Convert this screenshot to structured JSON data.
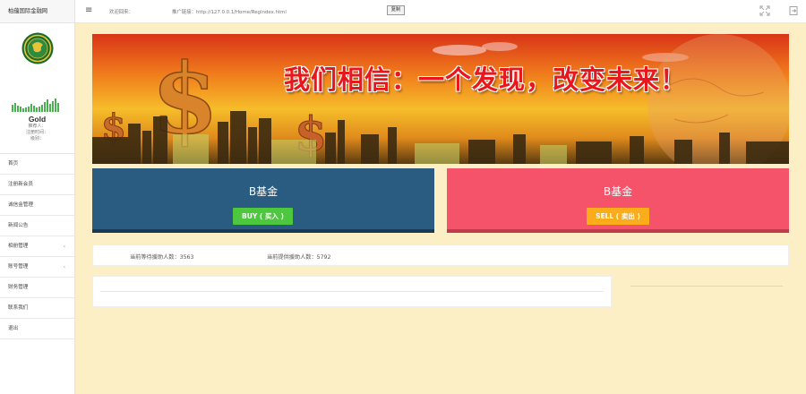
{
  "app": {
    "brand": "柏蕴国际金融网"
  },
  "user": {
    "level": "Gold",
    "referrer_label": "推荐人：",
    "register_time_label": "注册时间：",
    "status_label": "级别："
  },
  "nav": {
    "items": [
      {
        "label": "首页",
        "has_children": false
      },
      {
        "label": "注册新会员",
        "has_children": false
      },
      {
        "label": "诚信金管理",
        "has_children": false
      },
      {
        "label": "新闻公告",
        "has_children": false
      },
      {
        "label": "相册管理",
        "has_children": true
      },
      {
        "label": "账号管理",
        "has_children": true
      },
      {
        "label": "财务管理",
        "has_children": false
      },
      {
        "label": "联系我们",
        "has_children": false
      },
      {
        "label": "退出",
        "has_children": false
      }
    ],
    "chevron": "‹"
  },
  "topbar": {
    "menu_icon": "≡",
    "welcome": "欢迎回来：",
    "promo_link": "推广链接：http://127.0.0.1/Home/RegIndex.html",
    "copy_label": "复制"
  },
  "banner": {
    "slogan": "我们相信：一个发现，改变未来！"
  },
  "cards": {
    "buy": {
      "title": "B基金",
      "button": "BUY ( 买入 )",
      "color": "#2a5b80"
    },
    "sell": {
      "title": "B基金",
      "button": "SELL ( 卖出 )",
      "color": "#f5536a"
    }
  },
  "stats": {
    "waiting_help": "当前等待援助人数：3563",
    "providing_help": "当前提供援助人数：5792"
  },
  "colors": {
    "content_bg": "#fdefc5",
    "buy_button": "#4cc73e",
    "sell_button": "#fbac1a",
    "level_bars": "#4caf50"
  }
}
